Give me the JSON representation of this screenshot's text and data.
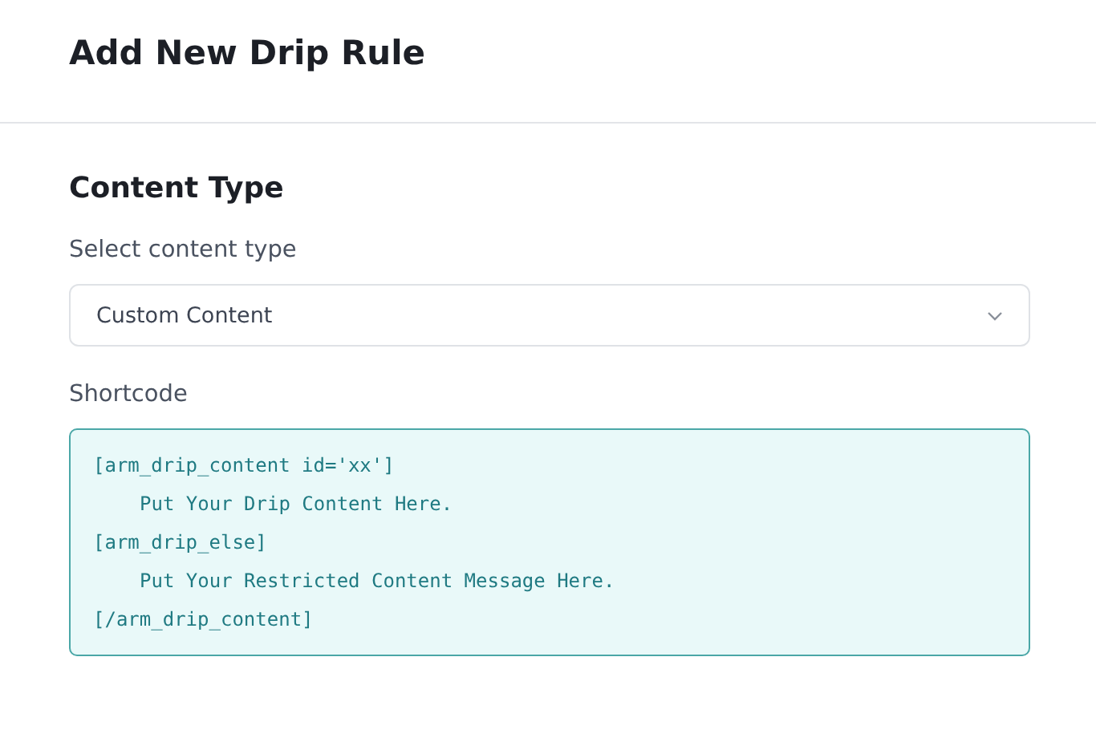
{
  "header": {
    "title": "Add New Drip Rule"
  },
  "section": {
    "title": "Content Type",
    "select": {
      "label": "Select content type",
      "value": "Custom Content"
    },
    "shortcode": {
      "label": "Shortcode",
      "lines": [
        {
          "kind": "tag",
          "text": "[arm_drip_content id='xx']"
        },
        {
          "kind": "content",
          "text": "Put Your Drip Content Here."
        },
        {
          "kind": "tag",
          "text": "[arm_drip_else]"
        },
        {
          "kind": "content",
          "text": "Put Your Restricted Content Message Here."
        },
        {
          "kind": "tag",
          "text": "[/arm_drip_content]"
        }
      ]
    }
  }
}
